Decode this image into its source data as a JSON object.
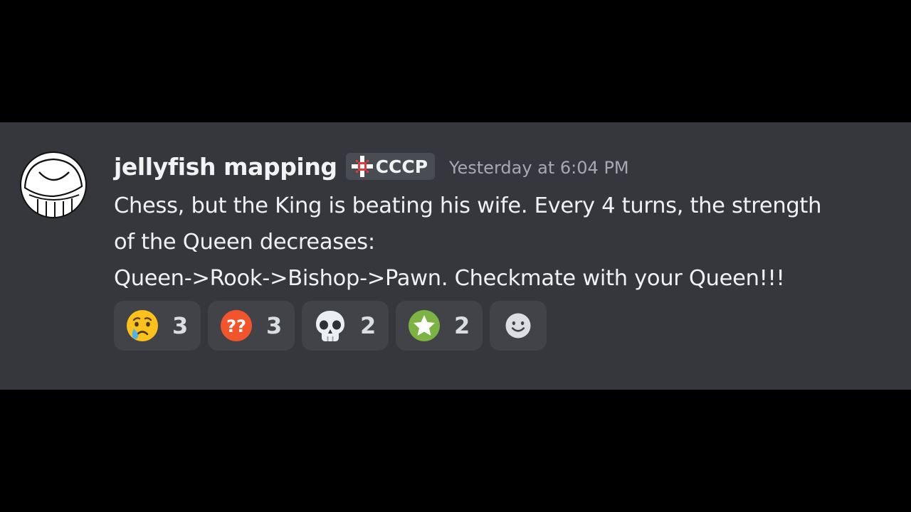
{
  "message": {
    "username": "jellyfish mapping",
    "tag": {
      "label": "CCCP",
      "icon": "pixel-compass-icon"
    },
    "timestamp": "Yesterday at 6:04 PM",
    "content_lines": [
      "Chess, but the King is beating his wife. Every 4 turns, the strength",
      "of the Queen decreases:",
      "Queen->Rook->Bishop->Pawn. Checkmate with your Queen!!!"
    ],
    "avatar": {
      "icon": "jellyfish-doodle-avatar"
    }
  },
  "reactions": [
    {
      "emoji": "crying-face-icon",
      "count": "3"
    },
    {
      "emoji": "double-question-mark-icon",
      "count": "3"
    },
    {
      "emoji": "skull-icon",
      "count": "2"
    },
    {
      "emoji": "star-badge-icon",
      "count": "2"
    }
  ],
  "add_reaction": {
    "icon": "smiley-add-reaction-icon"
  },
  "colors": {
    "page_background": "#000000",
    "message_background": "#36373d",
    "reaction_background": "#414349",
    "tag_background": "#4a4c53",
    "text": "#f0f1f3",
    "muted": "#a7a9b0"
  }
}
